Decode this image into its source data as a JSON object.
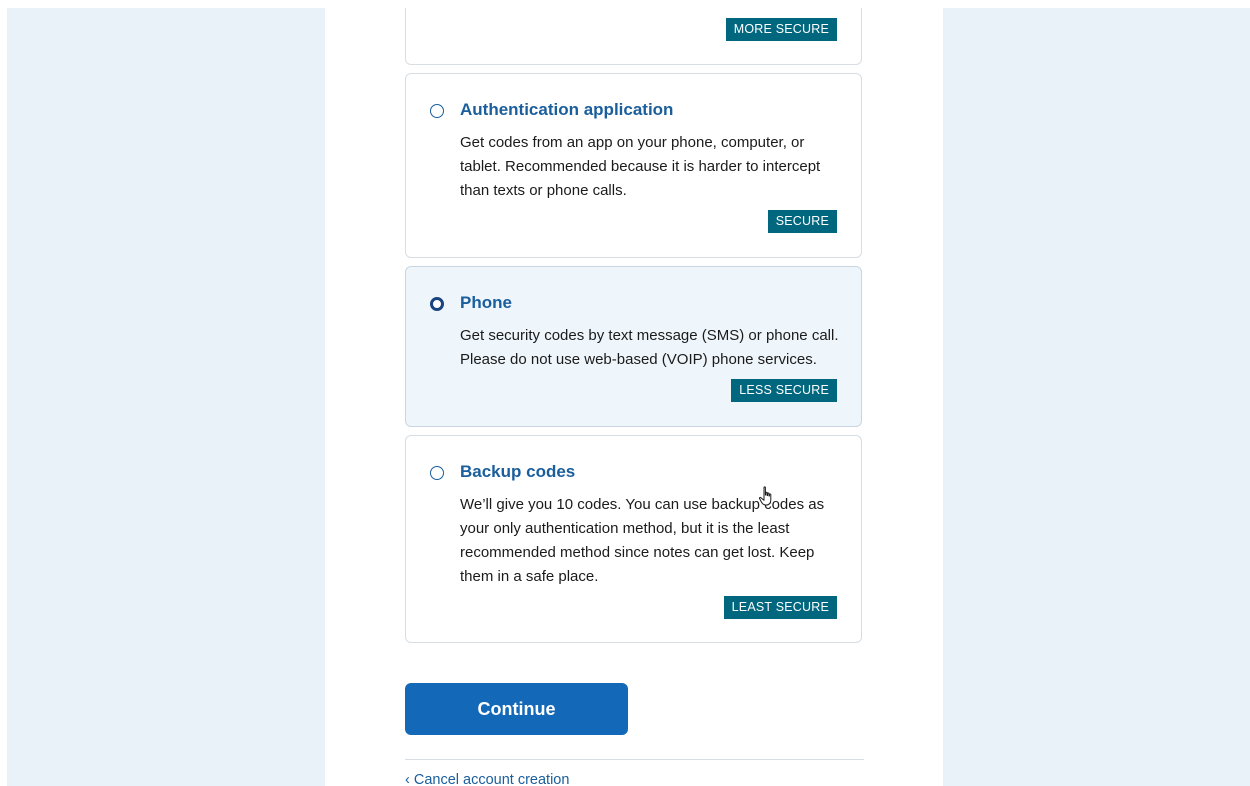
{
  "options": [
    {
      "title": "",
      "description": "",
      "badge": "MORE SECURE",
      "selected": false
    },
    {
      "title": "Authentication application",
      "description": "Get codes from an app on your phone, computer, or tablet. Recommended because it is harder to intercept than texts or phone calls.",
      "badge": "SECURE",
      "selected": false
    },
    {
      "title": "Phone",
      "description": "Get security codes by text message (SMS) or phone call. Please do not use web-based (VOIP) phone services.",
      "badge": "LESS SECURE",
      "selected": true
    },
    {
      "title": "Backup codes",
      "description": "We’ll give you 10 codes. You can use backup codes as your only authentication method, but it is the least recommended method since notes can get lost. Keep them in a safe place.",
      "badge": "LEAST SECURE",
      "selected": false
    }
  ],
  "actions": {
    "continue_label": "Continue",
    "cancel_label": "‹ Cancel account creation"
  },
  "colors": {
    "page_side": "#e9f1f9",
    "primary": "#1468b8",
    "badge": "#00677f",
    "title": "#1a5e9c",
    "selected_card": "#eef6fc"
  },
  "icons": {
    "cursor": "hand-pointer-icon",
    "radio": "radio-circle-icon"
  }
}
